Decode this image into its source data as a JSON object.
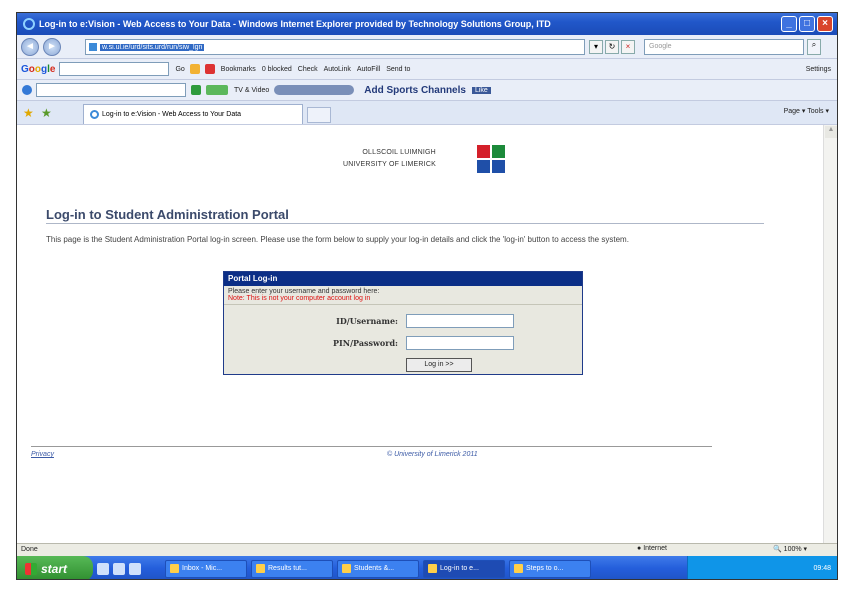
{
  "window": {
    "title": "Log-in to e:Vision - Web Access to Your Data - Windows Internet Explorer provided by Technology Solutions Group, ITD"
  },
  "address_bar": {
    "url": "w.si.ul.ie/urd/sits.urd/run/siw_lgn",
    "search_placeholder": "Google"
  },
  "google_toolbar": {
    "items": [
      "Go",
      "Bookmarks",
      "0 blocked",
      "Check",
      "AutoLink",
      "AutoFill",
      "Send to",
      "Settings"
    ]
  },
  "links_toolbar": {
    "tv_video": "TV & Video",
    "sports": "Add Sports Channels",
    "like": "Like"
  },
  "tab": {
    "label": "Log-in to e:Vision - Web Access to Your Data",
    "commands": "Page ▾   Tools ▾"
  },
  "page": {
    "logo_line1": "OLLSCOIL LUIMNIGH",
    "logo_line2": "UNIVERSITY OF LIMERICK",
    "heading": "Log-in to Student Administration Portal",
    "intro": "This page is the Student Administration Portal log-in screen. Please use the form below to supply your log-in details and click the 'log-in' button to access the system.",
    "login_box": {
      "header": "Portal Log-in",
      "note1": "Please enter your username and password here:",
      "note2": "Note: This is not your computer account log in",
      "username_label": "ID/Username:",
      "password_label": "PIN/Password:",
      "button": "Log in >>"
    },
    "privacy": "Privacy",
    "copyright": "© University of Limerick 2011"
  },
  "status_bar": {
    "status": "Done",
    "zone": "Internet",
    "zoom": "100%"
  },
  "taskbar": {
    "start": "start",
    "items": [
      "Inbox - Mic...",
      "Results tut...",
      "Students &...",
      "Log-in to e...",
      "Steps to o..."
    ],
    "clock": "09:48"
  },
  "colors": {
    "login_header": "#0b2e86",
    "heading": "#3b4a6b",
    "note_red": "#dd1111",
    "logo_red": "#d4202a",
    "logo_green": "#1c8a3a",
    "logo_blue": "#1f4fa8"
  }
}
